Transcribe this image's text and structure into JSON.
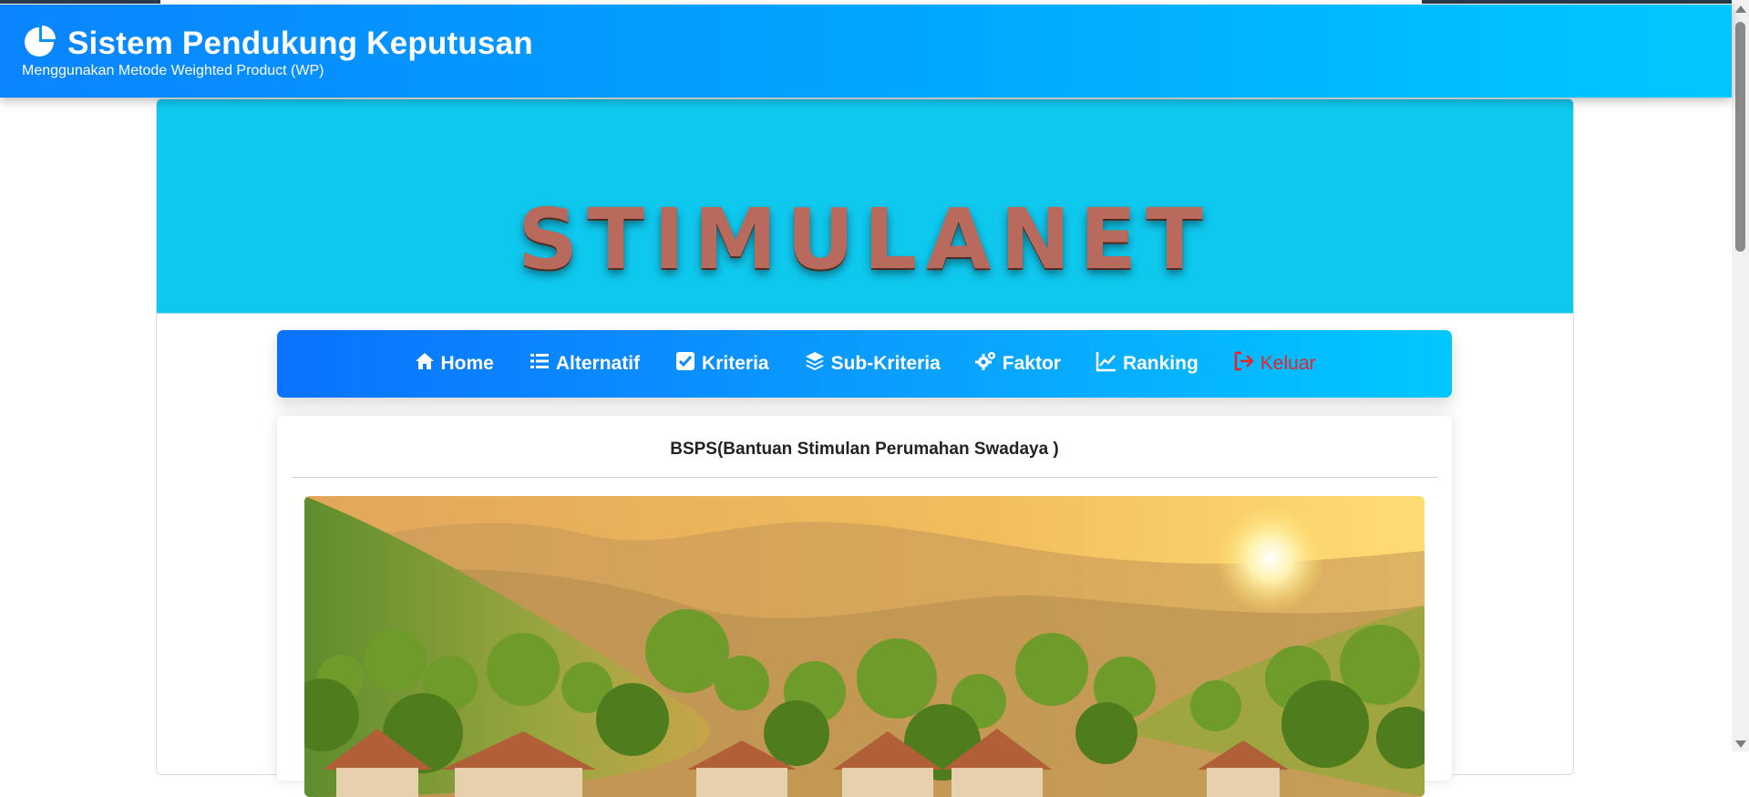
{
  "header": {
    "title": "Sistem Pendukung Keputusan",
    "subtitle": "Menggunakan Metode Weighted Product (WP)",
    "icon": "pie-chart-icon"
  },
  "banner": {
    "title": "STIMULANET"
  },
  "nav": {
    "items": [
      {
        "label": "Home",
        "icon": "home-icon"
      },
      {
        "label": "Alternatif",
        "icon": "list-icon"
      },
      {
        "label": "Kriteria",
        "icon": "check-square-icon"
      },
      {
        "label": "Sub-Kriteria",
        "icon": "layers-icon"
      },
      {
        "label": "Faktor",
        "icon": "cogs-icon"
      },
      {
        "label": "Ranking",
        "icon": "line-chart-icon"
      },
      {
        "label": "Keluar",
        "icon": "sign-out-icon"
      }
    ]
  },
  "content": {
    "title": "BSPS(Bantuan Stimulan Perumahan Swadaya )"
  },
  "colors": {
    "header_start": "#0a84ff",
    "header_end": "#00c8ff",
    "banner_bg": "#0fc8ee",
    "logout_text": "#e5252a"
  }
}
